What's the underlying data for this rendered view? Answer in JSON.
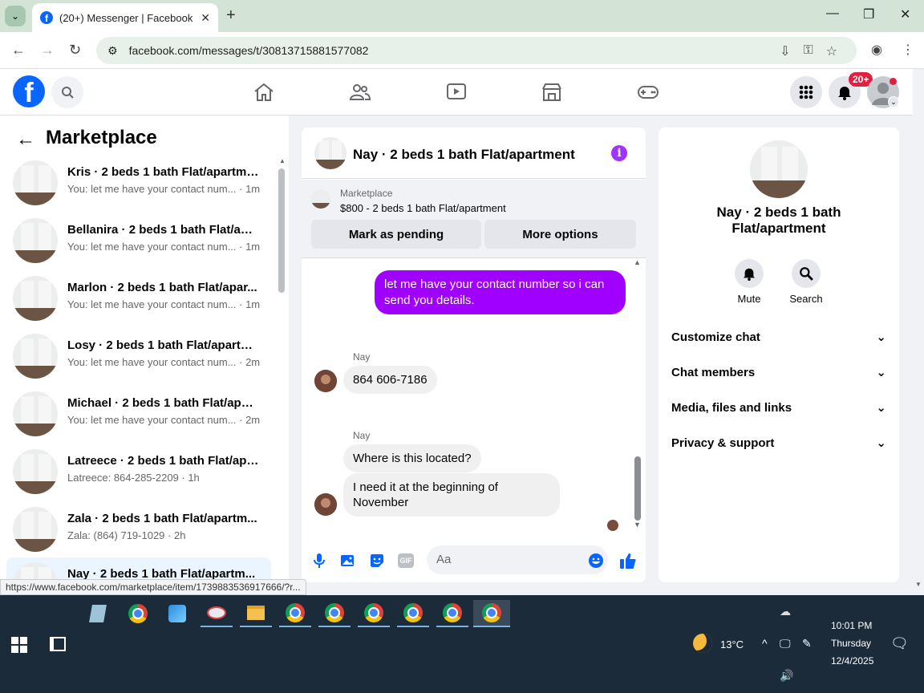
{
  "browser": {
    "tab_title": "(20+) Messenger | Facebook",
    "url": "facebook.com/messages/t/30813715881577082",
    "status_url": "https://www.facebook.com/marketplace/item/1739883536917666/?r..."
  },
  "fb_header": {
    "notifications_badge": "20+"
  },
  "left_panel": {
    "title": "Marketplace",
    "conversations": [
      {
        "name": "Kris · 2 beds 1 bath Flat/apartme...",
        "snippet": "You: let me have your contact num... · 1m"
      },
      {
        "name": "Bellanira · 2 beds 1 bath Flat/apa...",
        "snippet": "You: let me have your contact num... · 1m"
      },
      {
        "name": "Marlon · 2 beds 1 bath Flat/apar...",
        "snippet": "You: let me have your contact num... · 1m"
      },
      {
        "name": "Losy · 2 beds 1 bath Flat/apartm...",
        "snippet": "You: let me have your contact num... · 2m"
      },
      {
        "name": "Michael · 2 beds 1 bath Flat/apar...",
        "snippet": "You: let me have your contact num... · 2m"
      },
      {
        "name": "Latreece · 2 beds 1 bath Flat/apa...",
        "snippet": "Latreece: 864-285-2209 · 1h"
      },
      {
        "name": "Zala · 2 beds 1 bath Flat/apartm...",
        "snippet": "Zala: (864) 719-1029 · 2h"
      },
      {
        "name": "Nay · 2 beds 1 bath Flat/apartm...",
        "snippet": ""
      }
    ]
  },
  "chat": {
    "title": "Nay · 2 beds 1 bath Flat/apartment",
    "marketplace_label": "Marketplace",
    "listing": "$800 - 2 beds 1 bath Flat/apartment",
    "mark_pending": "Mark as pending",
    "more_options": "More options",
    "outgoing": "let me have your contact number so i can send you details.",
    "sender1": "Nay",
    "incoming1": "864 606-7186",
    "sender2": "Nay",
    "incoming2": "Where is this located?",
    "incoming3": "I need  it at the beginning of November",
    "input_placeholder": "Aa"
  },
  "right_panel": {
    "title": "Nay · 2 beds 1 bath Flat/apartment",
    "mute": "Mute",
    "search": "Search",
    "sections": [
      "Customize chat",
      "Chat members",
      "Media, files and links",
      "Privacy & support"
    ]
  },
  "taskbar": {
    "temperature": "13°C",
    "time": "10:01 PM",
    "day": "Thursday",
    "date": "12/4/2025"
  }
}
